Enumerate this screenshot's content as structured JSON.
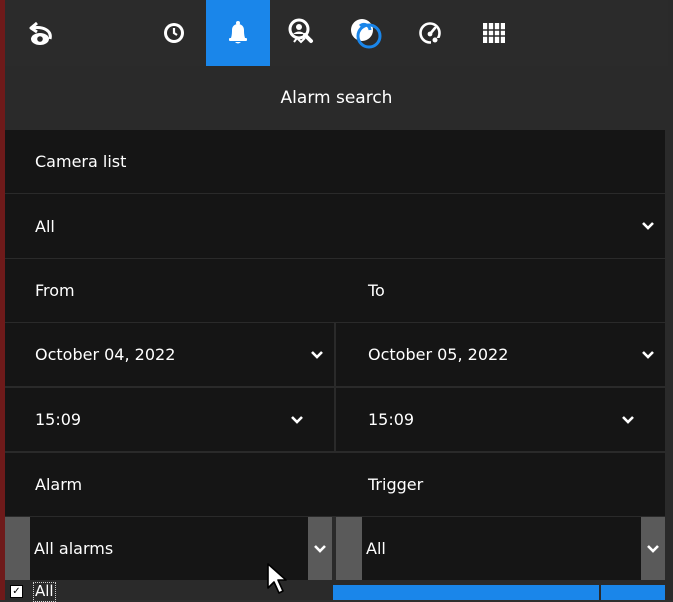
{
  "toolbar": {
    "buttons": [
      {
        "icon": "back-icon"
      },
      {
        "icon": "clock-icon"
      },
      {
        "icon": "bell-icon",
        "active": true
      },
      {
        "icon": "search-person-icon"
      },
      {
        "icon": "overlap-circles-icon"
      },
      {
        "icon": "gauge-icon"
      },
      {
        "icon": "grid-icon"
      }
    ],
    "accent": "#1a86ea"
  },
  "header": {
    "title": "Alarm search"
  },
  "camera": {
    "label": "Camera list",
    "selected": "All"
  },
  "range": {
    "from_label": "From",
    "to_label": "To",
    "from_date": "October 04, 2022",
    "to_date": "October 05, 2022",
    "from_time": "15:09",
    "to_time": "15:09"
  },
  "filters": {
    "alarm_label": "Alarm",
    "trigger_label": "Trigger",
    "alarm_selected": "All alarms",
    "trigger_selected": "All"
  },
  "list": {
    "all_label": "All",
    "all_checked": true
  }
}
